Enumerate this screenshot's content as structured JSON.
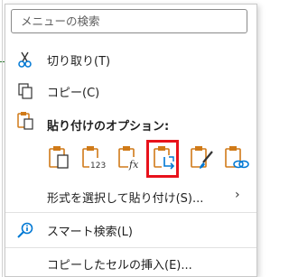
{
  "menu": {
    "search_placeholder": "メニューの検索",
    "cut_label": "切り取り(T)",
    "copy_label": "コピー(C)",
    "paste_options_label": "貼り付けのオプション:",
    "paste_options": [
      {
        "name": "paste",
        "icon": "clipboard-paste-icon"
      },
      {
        "name": "paste-values",
        "icon": "clipboard-values-123-icon",
        "text": "123"
      },
      {
        "name": "paste-formulas",
        "icon": "clipboard-formulas-fx-icon",
        "text": "fx"
      },
      {
        "name": "paste-transpose",
        "icon": "clipboard-transpose-icon"
      },
      {
        "name": "paste-formatting",
        "icon": "clipboard-formatting-brush-icon"
      },
      {
        "name": "paste-link",
        "icon": "clipboard-link-icon"
      }
    ],
    "paste_special_label": "形式を選択して貼り付け(S)...",
    "smart_lookup_label": "スマート検索(L)",
    "insert_copied_label": "コピーしたセルの挿入(E)..."
  },
  "colors": {
    "accent": "#0078d4",
    "clipboard_orange": "#d07a18",
    "highlight_red": "#e8121b"
  }
}
